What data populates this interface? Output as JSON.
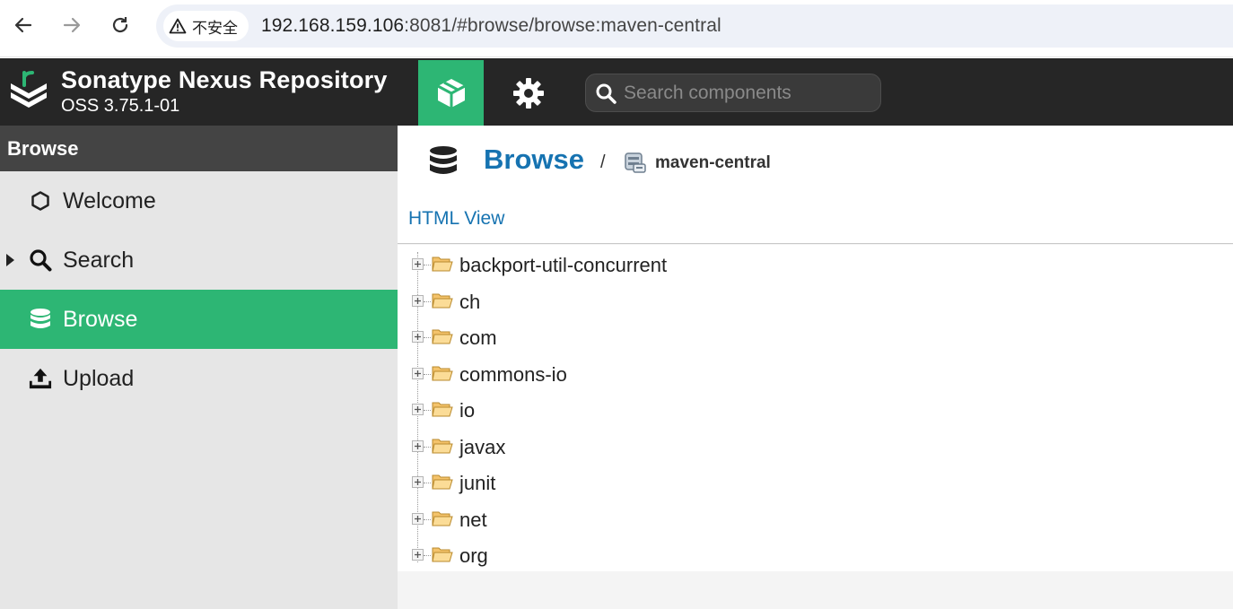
{
  "browser": {
    "security_label": "不安全",
    "url_host": "192.168.159.106",
    "url_rest": ":8081/#browse/browse:maven-central"
  },
  "header": {
    "brand_title": "Sonatype Nexus Repository",
    "brand_version": "OSS 3.75.1-01",
    "search_placeholder": "Search components"
  },
  "sidebar": {
    "title": "Browse",
    "items": [
      {
        "label": "Welcome",
        "icon": "hexagon-icon"
      },
      {
        "label": "Search",
        "icon": "search-icon"
      },
      {
        "label": "Browse",
        "icon": "database-icon",
        "active": true
      },
      {
        "label": "Upload",
        "icon": "upload-icon"
      }
    ]
  },
  "main": {
    "breadcrumb_title": "Browse",
    "breadcrumb_sep": "/",
    "repo_name": "maven-central",
    "html_view_label": "HTML View",
    "tree": [
      "backport-util-concurrent",
      "ch",
      "com",
      "commons-io",
      "io",
      "javax",
      "junit",
      "net",
      "org"
    ]
  },
  "colors": {
    "accent_green": "#2db674",
    "header_dark": "#262626",
    "link_blue": "#1673b1",
    "sidebar_bg": "#e6e6e6"
  }
}
